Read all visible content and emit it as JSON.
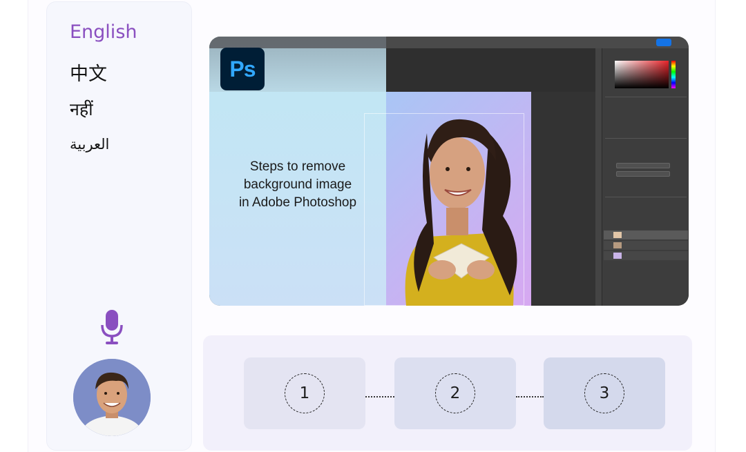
{
  "languages": [
    {
      "label": "English",
      "selected": true
    },
    {
      "label": "中文"
    },
    {
      "label": "नहीं"
    },
    {
      "label": "العربية"
    }
  ],
  "hero": {
    "app_logo": "Ps",
    "title_lines": [
      "Steps to remove",
      "background image",
      "in Adobe Photoshop"
    ]
  },
  "steps": [
    "1",
    "2",
    "3"
  ],
  "icons": {
    "mic": "microphone-icon",
    "avatar": "user-avatar"
  },
  "colors": {
    "accent": "#8a4fc0",
    "ps_bg": "#001e36",
    "ps_fg": "#31a8ff"
  }
}
